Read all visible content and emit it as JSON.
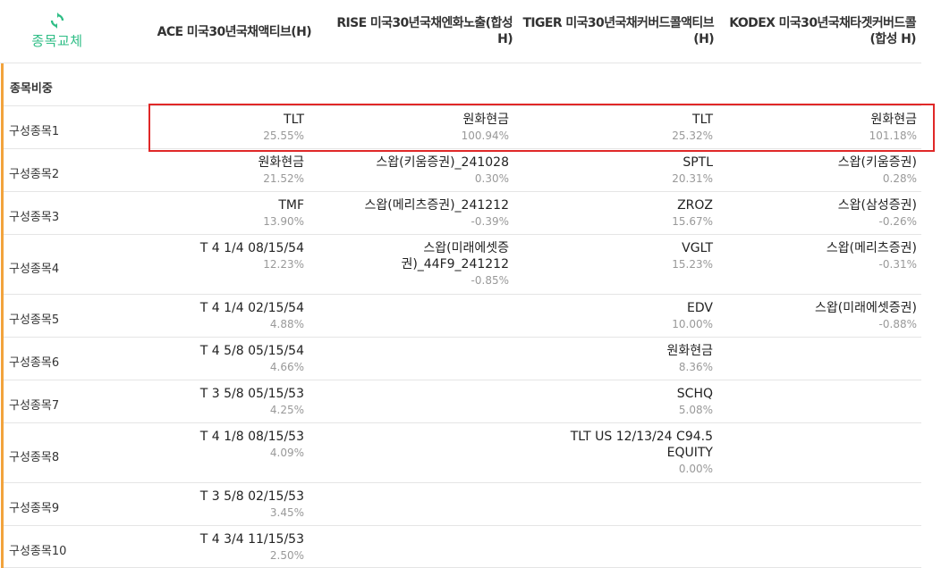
{
  "swap_label": "종목교체",
  "columns": [
    "ACE 미국30년국채액티브(H)",
    "RISE 미국30년국채엔화노출(합성 H)",
    "TIGER 미국30년국채커버드콜액티브(H)",
    "KODEX 미국30년국채타겟커버드콜(합성 H)"
  ],
  "section_label": "종목비중",
  "rows": [
    {
      "label": "구성종목1",
      "cells": [
        {
          "name": "TLT",
          "pct": "25.55%"
        },
        {
          "name": "원화현금",
          "pct": "100.94%"
        },
        {
          "name": "TLT",
          "pct": "25.32%"
        },
        {
          "name": "원화현금",
          "pct": "101.18%"
        }
      ]
    },
    {
      "label": "구성종목2",
      "cells": [
        {
          "name": "원화현금",
          "pct": "21.52%"
        },
        {
          "name": "스왑(키움증권)_241028",
          "pct": "0.30%"
        },
        {
          "name": "SPTL",
          "pct": "20.31%"
        },
        {
          "name": "스왑(키움증권)",
          "pct": "0.28%"
        }
      ]
    },
    {
      "label": "구성종목3",
      "cells": [
        {
          "name": "TMF",
          "pct": "13.90%"
        },
        {
          "name": "스왑(메리츠증권)_241212",
          "pct": "-0.39%"
        },
        {
          "name": "ZROZ",
          "pct": "15.67%"
        },
        {
          "name": "스왑(삼성증권)",
          "pct": "-0.26%"
        }
      ]
    },
    {
      "label": "구성종목4",
      "cells": [
        {
          "name": "T 4 1/4 08/15/54",
          "pct": "12.23%"
        },
        {
          "name": "스왑(미래에셋증권)_44F9_241212",
          "pct": "-0.85%"
        },
        {
          "name": "VGLT",
          "pct": "15.23%"
        },
        {
          "name": "스왑(메리츠증권)",
          "pct": "-0.31%"
        }
      ]
    },
    {
      "label": "구성종목5",
      "cells": [
        {
          "name": "T 4 1/4 02/15/54",
          "pct": "4.88%"
        },
        {
          "name": "",
          "pct": ""
        },
        {
          "name": "EDV",
          "pct": "10.00%"
        },
        {
          "name": "스왑(미래에셋증권)",
          "pct": "-0.88%"
        }
      ]
    },
    {
      "label": "구성종목6",
      "cells": [
        {
          "name": "T 4 5/8 05/15/54",
          "pct": "4.66%"
        },
        {
          "name": "",
          "pct": ""
        },
        {
          "name": "원화현금",
          "pct": "8.36%"
        },
        {
          "name": "",
          "pct": ""
        }
      ]
    },
    {
      "label": "구성종목7",
      "cells": [
        {
          "name": "T 3 5/8 05/15/53",
          "pct": "4.25%"
        },
        {
          "name": "",
          "pct": ""
        },
        {
          "name": "SCHQ",
          "pct": "5.08%"
        },
        {
          "name": "",
          "pct": ""
        }
      ]
    },
    {
      "label": "구성종목8",
      "cells": [
        {
          "name": "T 4 1/8 08/15/53",
          "pct": "4.09%"
        },
        {
          "name": "",
          "pct": ""
        },
        {
          "name": "TLT US 12/13/24 C94.5 EQUITY",
          "pct": "0.00%"
        },
        {
          "name": "",
          "pct": ""
        }
      ]
    },
    {
      "label": "구성종목9",
      "cells": [
        {
          "name": "T 3 5/8 02/15/53",
          "pct": "3.45%"
        },
        {
          "name": "",
          "pct": ""
        },
        {
          "name": "",
          "pct": ""
        },
        {
          "name": "",
          "pct": ""
        }
      ]
    },
    {
      "label": "구성종목10",
      "cells": [
        {
          "name": "T 4 3/4 11/15/53",
          "pct": "2.50%"
        },
        {
          "name": "",
          "pct": ""
        },
        {
          "name": "",
          "pct": ""
        },
        {
          "name": "",
          "pct": ""
        }
      ]
    }
  ],
  "colors": {
    "accent": "#f2a33c",
    "swap": "#2ebd85",
    "highlight": "#e02828"
  }
}
